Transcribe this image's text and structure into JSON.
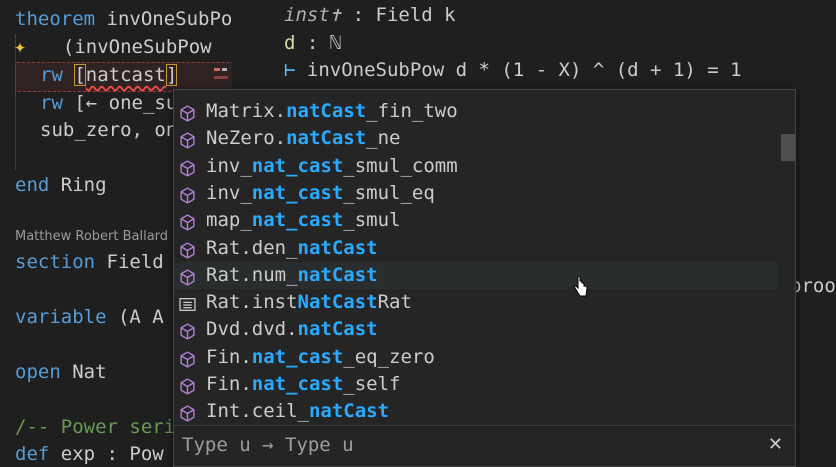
{
  "editor": {
    "lines": [
      {
        "kw": "theorem ",
        "text": "invOneSubPow"
      },
      {
        "text": "  (invOneSubPow"
      },
      {
        "kw": "rw ",
        "open": "[",
        "name": "natcast",
        "close": "]"
      },
      {
        "kw": "rw ",
        "text": "[← one_sub_"
      },
      {
        "text": "sub_zero, one"
      },
      {
        "kw": "end ",
        "text": "Ring"
      },
      {
        "kw": "section ",
        "text": "Field"
      },
      {
        "kw": "variable ",
        "text": "(A A"
      },
      {
        "kw": "open ",
        "text": "Nat"
      },
      {
        "cm": "/-- Power series"
      },
      {
        "kw": "def ",
        "text": "exp : Pow"
      }
    ],
    "author": "Matthew Robert Ballard"
  },
  "infoview": {
    "hyp1_name": "inst✝",
    "hyp1_type": " : Field k",
    "hyp2_name": "d",
    "hyp2_type": " : ℕ",
    "turnstile": "⊢",
    "goal": " invOneSubPow d * (1 - X) ^ (d + 1) = 1",
    "ghost_text": "proo"
  },
  "suggest": {
    "items": [
      {
        "kind": "cube",
        "parts": [
          "Matrix.",
          "natCast",
          "_fin_two"
        ]
      },
      {
        "kind": "cube",
        "parts": [
          "NeZero.",
          "natCast",
          "_ne"
        ]
      },
      {
        "kind": "cube",
        "parts": [
          "inv_",
          "nat_cast",
          "_smul_comm"
        ]
      },
      {
        "kind": "cube",
        "parts": [
          "inv_",
          "nat_cast",
          "_smul_eq"
        ]
      },
      {
        "kind": "cube",
        "parts": [
          "map_",
          "nat_cast",
          "_smul"
        ]
      },
      {
        "kind": "cube",
        "parts": [
          "Rat.den_",
          "natCast",
          ""
        ]
      },
      {
        "kind": "cube",
        "parts": [
          "Rat.num_",
          "natCast",
          ""
        ],
        "selected": true
      },
      {
        "kind": "struct",
        "parts": [
          "Rat.inst",
          "NatCast",
          "Rat"
        ]
      },
      {
        "kind": "cube",
        "parts": [
          "Dvd.dvd.",
          "natCast",
          ""
        ]
      },
      {
        "kind": "cube",
        "parts": [
          "Fin.",
          "nat_cast",
          "_eq_zero"
        ]
      },
      {
        "kind": "cube",
        "parts": [
          "Fin.",
          "nat_cast",
          "_self"
        ]
      },
      {
        "kind": "cube",
        "parts": [
          "Int.ceil_",
          "natCast",
          ""
        ]
      }
    ],
    "detail": "Type u → Type u",
    "close_glyph": "✕"
  },
  "colors": {
    "keyword": "#569cd6",
    "match": "#2aaaff",
    "cube_icon": "#b180d7",
    "background": "#1f1f1f"
  }
}
